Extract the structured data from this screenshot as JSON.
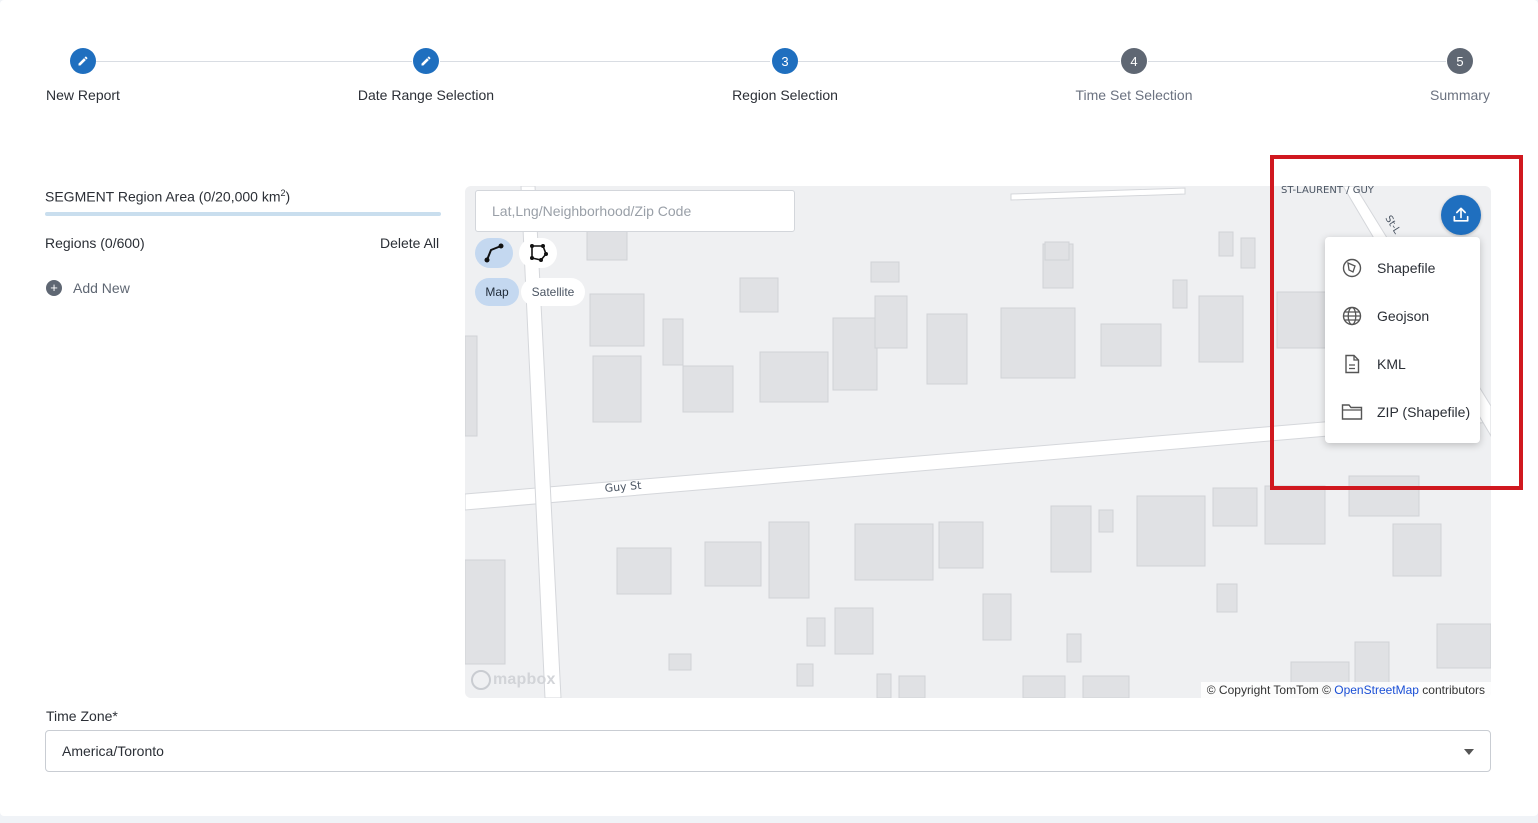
{
  "stepper": {
    "steps": [
      {
        "label": "New Report",
        "status": "done",
        "marker": "pencil-icon"
      },
      {
        "label": "Date Range Selection",
        "status": "done",
        "marker": "pencil-icon"
      },
      {
        "label": "Region Selection",
        "status": "current",
        "number": "3"
      },
      {
        "label": "Time Set Selection",
        "status": "todo",
        "number": "4"
      },
      {
        "label": "Summary",
        "status": "todo",
        "number": "5"
      }
    ]
  },
  "region_panel": {
    "area_title": "SEGMENT Region Area (0/20,000 km",
    "area_sup": "2",
    "area_close": ")",
    "regions_label": "Regions (0/600)",
    "delete_all": "Delete All",
    "add_new": "Add New"
  },
  "map": {
    "search_placeholder": "Lat,Lng/Neighborhood/Zip Code",
    "tools": [
      "line-draw-icon",
      "polygon-draw-icon"
    ],
    "view_map": "Map",
    "view_satellite": "Satellite",
    "street_label_1": "Guy St",
    "street_label_2": "ST-LAURENT / GUY",
    "street_label_3": "St-L",
    "logo_text": "mapbox",
    "attribution_prefix": "© Copyright TomTom © ",
    "attribution_link": "OpenStreetMap",
    "attribution_suffix": " contributors",
    "upload_icon": "upload-icon",
    "upload_menu": [
      {
        "label": "Shapefile",
        "icon": "shapefile-icon"
      },
      {
        "label": "Geojson",
        "icon": "globe-icon"
      },
      {
        "label": "KML",
        "icon": "file-icon"
      },
      {
        "label": "ZIP (Shapefile)",
        "icon": "folder-icon"
      }
    ]
  },
  "time_zone": {
    "label": "Time Zone*",
    "value": "America/Toronto"
  },
  "colors": {
    "accent": "#1f6fbf",
    "inactive_step": "#5f6773",
    "highlight": "#d0181f"
  }
}
